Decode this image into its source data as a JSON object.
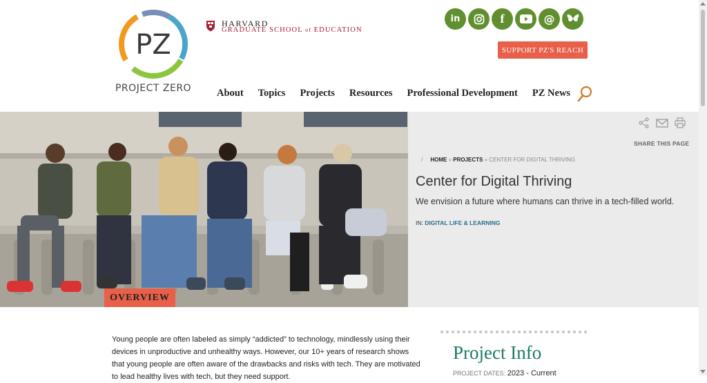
{
  "header": {
    "logo_text": "PROJECT ZERO",
    "logo_letters": "PZ",
    "harvard_line1": "HARVARD",
    "harvard_line2": "GRADUATE SCHOOL",
    "harvard_line2_of": "of",
    "harvard_line2_end": "EDUCATION",
    "support_label": "SUPPORT PZ'S REACH",
    "socials": [
      "linkedin-icon",
      "instagram-icon",
      "facebook-icon",
      "youtube-icon",
      "threads-icon",
      "bluesky-icon"
    ],
    "nav": [
      "About",
      "Topics",
      "Projects",
      "Resources",
      "Professional Development",
      "PZ News"
    ]
  },
  "hero": {
    "share_label": "SHARE THIS PAGE",
    "breadcrumb": {
      "sep": "/",
      "home": "HOME",
      "projects": "PROJECTS",
      "current": "CENTER FOR DIGITAL THRIVING"
    },
    "title": "Center for Digital Thriving",
    "tagline": "We envision a future where humans can thrive in a tech-filled world.",
    "in_label": "IN:",
    "in_link": "DIGITAL LIFE & LEARNING",
    "overview_label": "OVERVIEW"
  },
  "main": {
    "intro_line1": "Young people are often labeled as simply “addicted” to technology, mindlessly using their",
    "intro_line2": "devices in unproductive and unhealthy ways. However, our 10+ years of research shows",
    "intro_line3": "that young people are often aware of the drawbacks and risks with tech. They are motivated",
    "intro_line4": "to lead healthy lives with tech, but they need support."
  },
  "project_info": {
    "title": "Project Info",
    "dates_label": "PROJECT DATES:",
    "dates_value": "2023 - Current"
  },
  "colors": {
    "accent_green": "#5f8f2f",
    "accent_orange": "#e8604a",
    "harvard_crimson": "#a51c30",
    "teal": "#1a7a64"
  }
}
